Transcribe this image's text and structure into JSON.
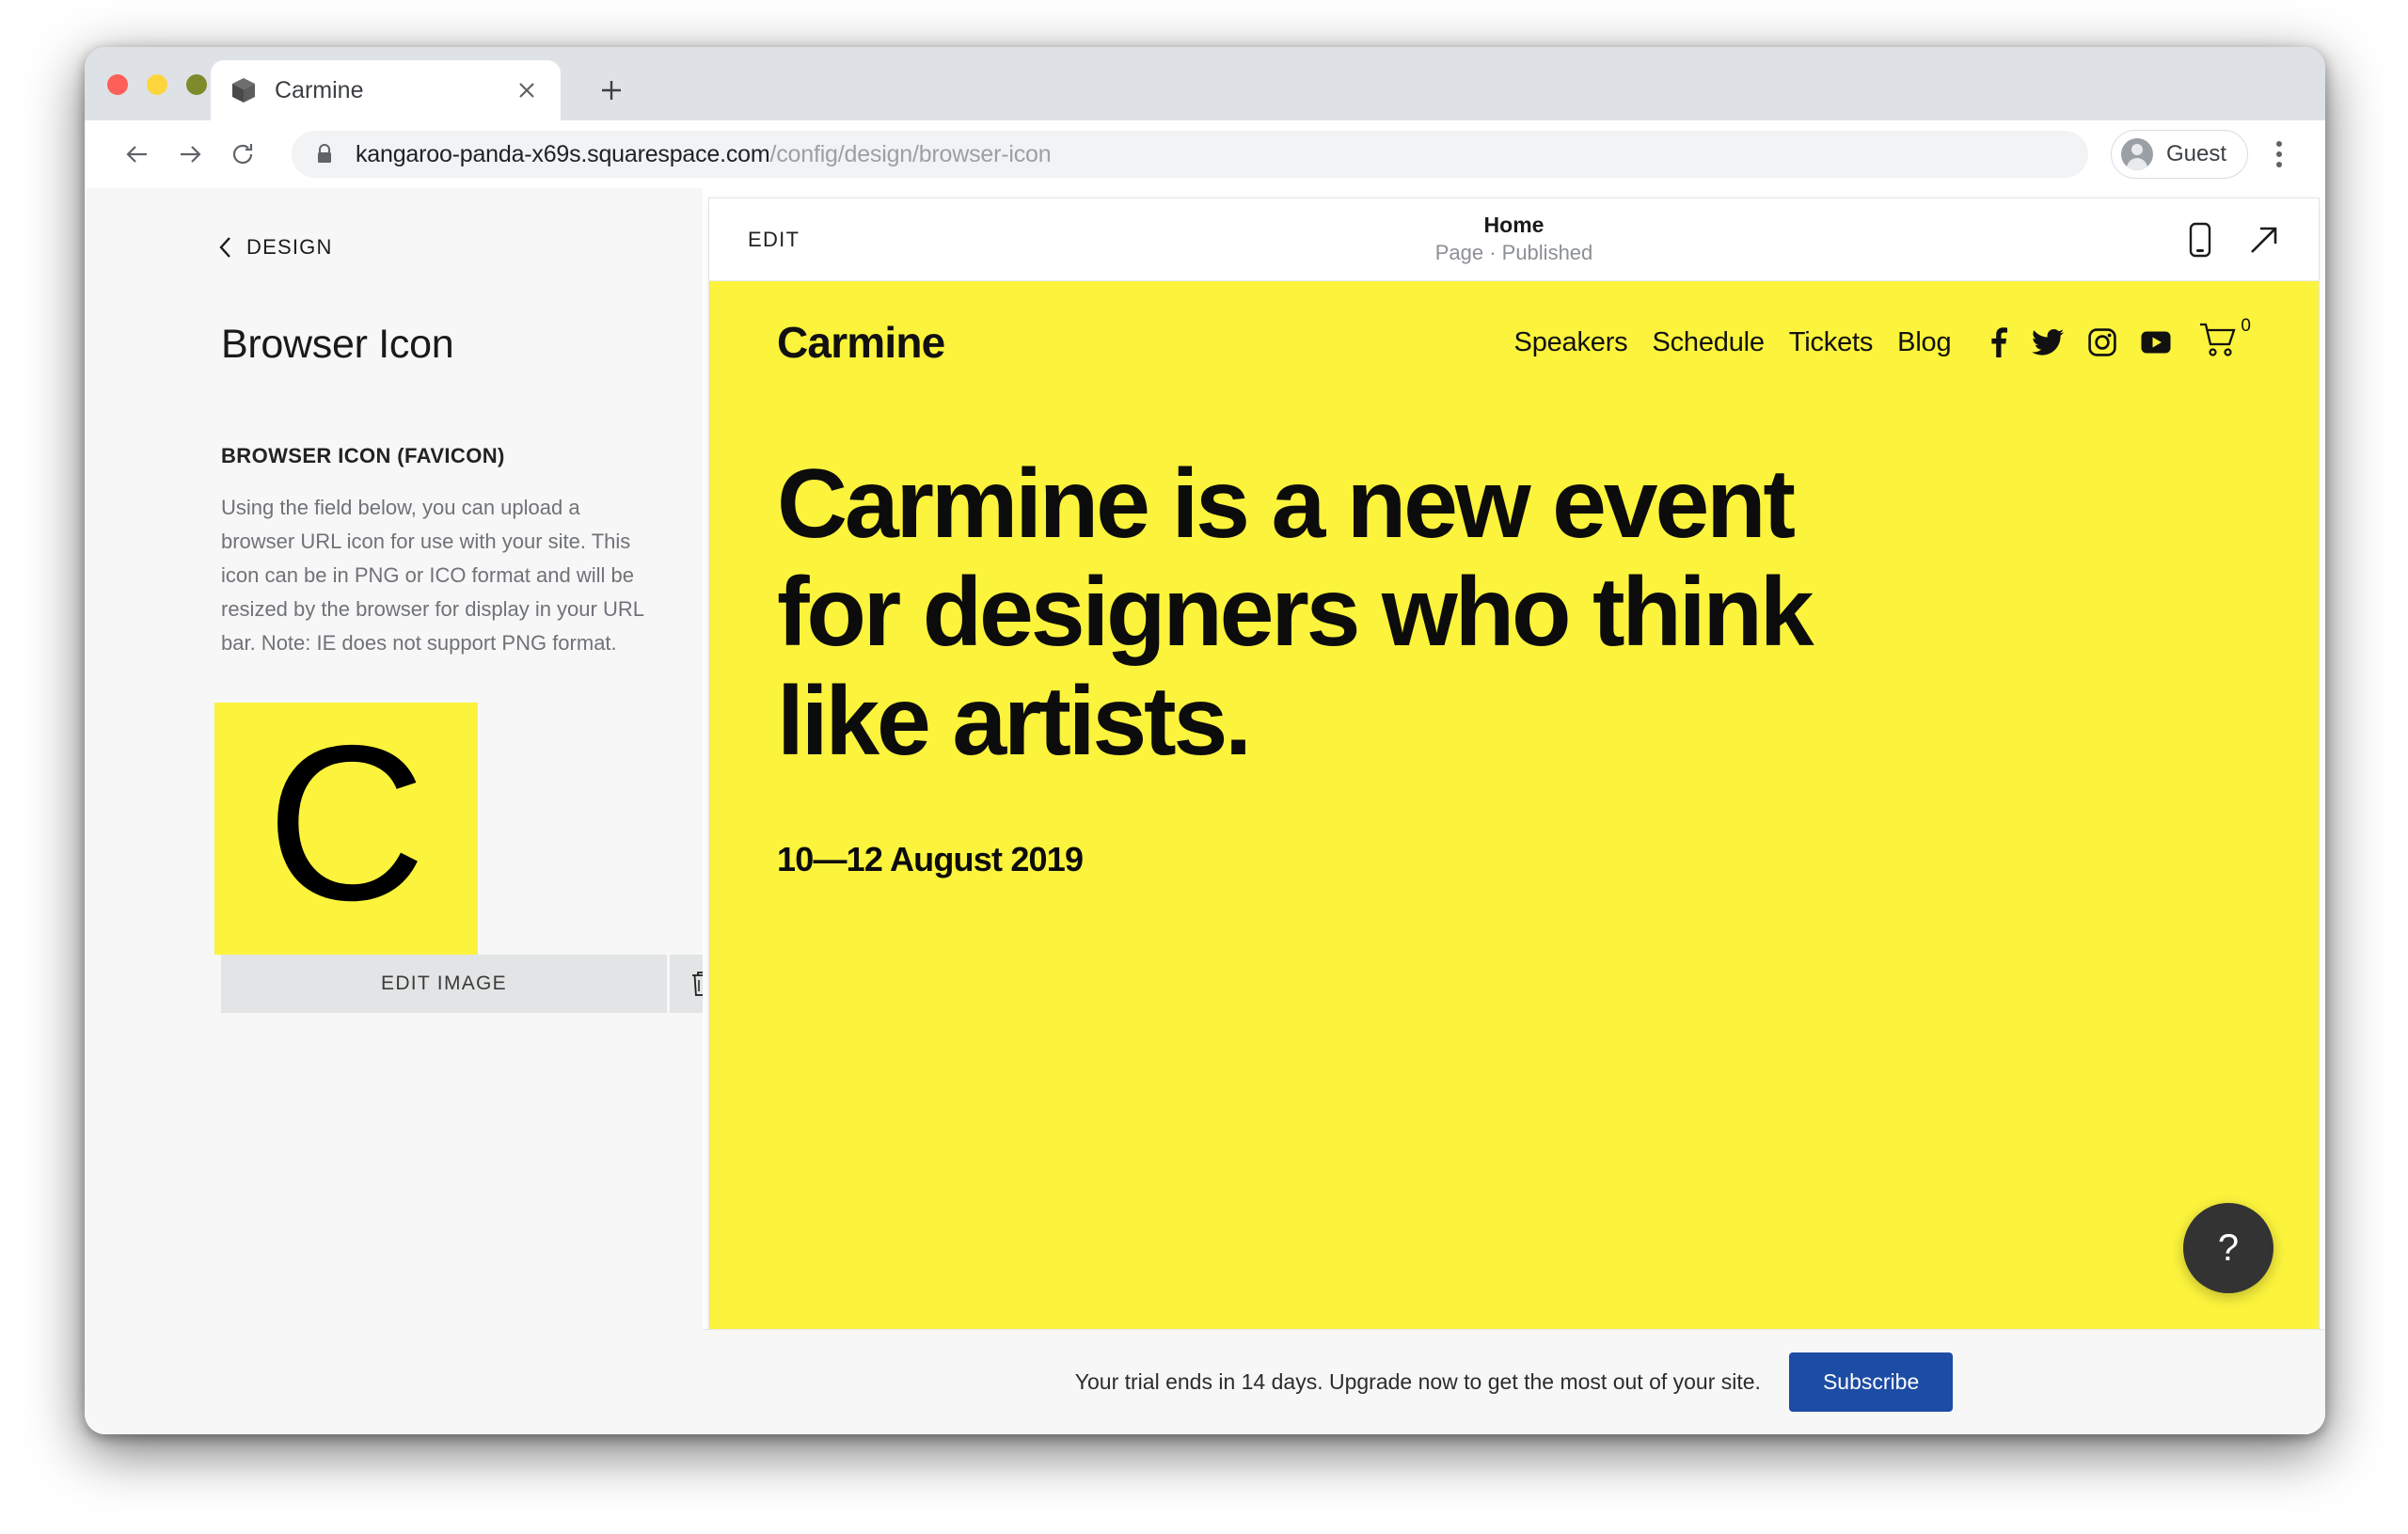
{
  "browser": {
    "tab": {
      "title": "Carmine",
      "favicon": "cube-icon",
      "close": "×"
    },
    "new_tab_label": "+",
    "nav": {
      "back": "←",
      "forward": "→",
      "reload": "⟳"
    },
    "omnibox": {
      "lock": "lock-icon",
      "host": "kangaroo-panda-x69s.squarespace.com",
      "path": "/config/design/browser-icon"
    },
    "profile": {
      "name": "Guest",
      "avatar": "account-circle-icon"
    },
    "menu": "kebab-menu-icon"
  },
  "config_panel": {
    "back_label": "DESIGN",
    "title": "Browser Icon",
    "section_label": "BROWSER ICON (FAVICON)",
    "section_description": "Using the field below, you can upload a browser URL icon for use with your site. This icon can be in PNG or ICO format and will be resized by the browser for display in your URL bar. Note: IE does not support PNG format.",
    "favicon_letter": "C",
    "favicon_bg": "#FBF33C",
    "edit_image_label": "EDIT IMAGE",
    "delete_label": "trash-icon"
  },
  "preview": {
    "edit_label": "EDIT",
    "page_name": "Home",
    "page_status": "Page · Published",
    "tools": {
      "mobile": "mobile-icon",
      "open_external": "arrow-up-right-icon"
    },
    "help_label": "?"
  },
  "site": {
    "brand": "Carmine",
    "nav_links": [
      "Speakers",
      "Schedule",
      "Tickets",
      "Blog"
    ],
    "social": [
      "facebook-icon",
      "twitter-icon",
      "instagram-icon",
      "youtube-icon"
    ],
    "cart_count": "0",
    "hero_title": "Carmine is a new event for designers who think like artists.",
    "hero_date": "10—12 August 2019",
    "background_color": "#FBF33C",
    "text_color": "#0C0C0C"
  },
  "trial": {
    "message": "Your trial ends in 14 days. Upgrade now to get the most out of your site.",
    "subscribe_label": "Subscribe",
    "button_color": "#1D4CA4"
  }
}
